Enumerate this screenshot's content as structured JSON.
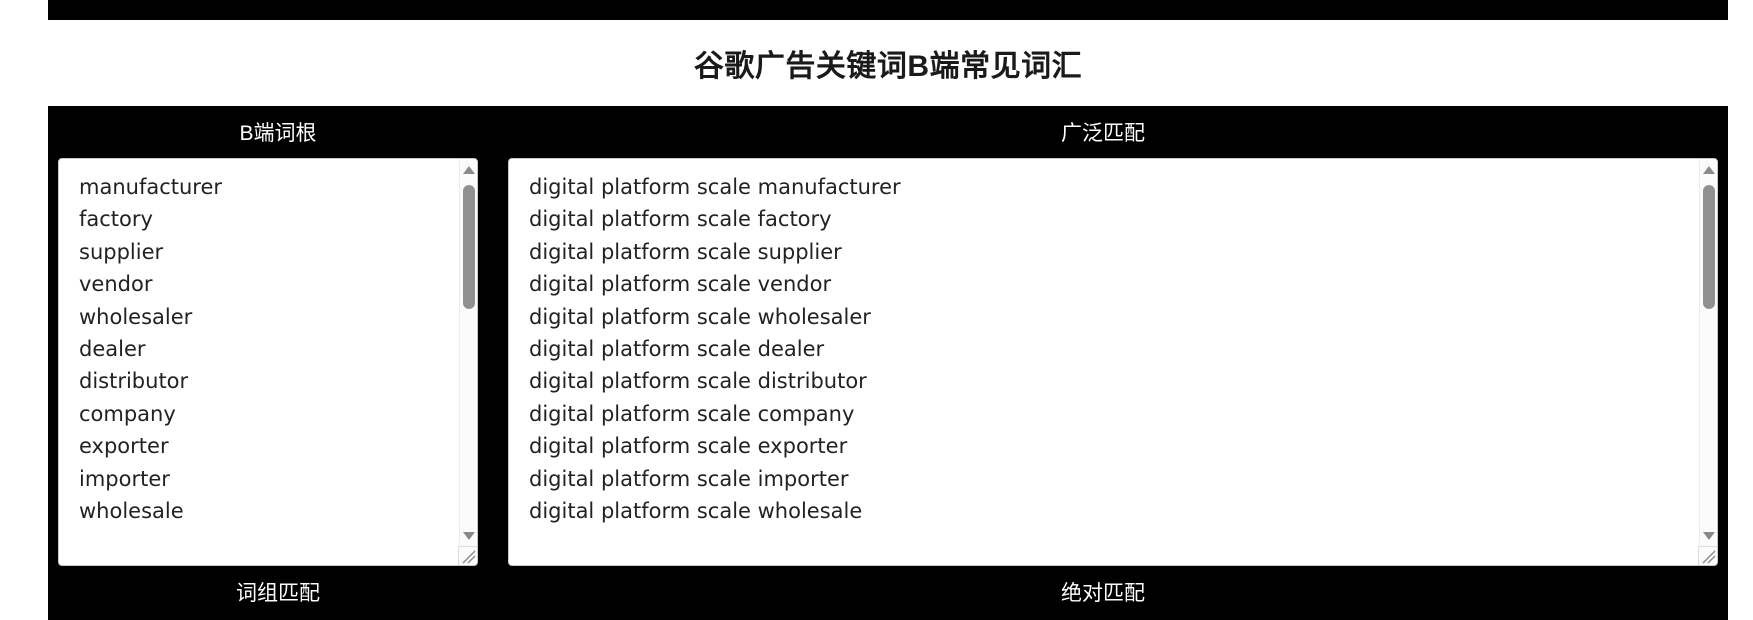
{
  "page": {
    "title": "谷歌广告关键词B端常见词汇"
  },
  "columns": {
    "row1": {
      "left_header": "B端词根",
      "right_header": "广泛匹配"
    },
    "row2": {
      "left_header": "词组匹配",
      "right_header": "绝对匹配"
    }
  },
  "left_textarea": {
    "lines": [
      "manufacturer",
      "factory",
      "supplier",
      "vendor",
      "wholesaler",
      "dealer",
      "distributor",
      "company",
      "exporter",
      "importer",
      "wholesale"
    ]
  },
  "right_textarea": {
    "lines": [
      "digital platform scale manufacturer",
      "digital platform scale factory",
      "digital platform scale supplier",
      "digital platform scale vendor",
      "digital platform scale wholesaler",
      "digital platform scale dealer",
      "digital platform scale distributor",
      "digital platform scale company",
      "digital platform scale exporter",
      "digital platform scale importer",
      "digital platform scale wholesale"
    ]
  },
  "icons": {
    "scroll_up": "triangle-up-icon",
    "scroll_down": "triangle-down-icon",
    "resize": "resize-grip-icon"
  },
  "colors": {
    "panel_bg": "#000000",
    "page_bg": "#ffffff",
    "text": "#222222",
    "header_text": "#ffffff",
    "scrollbar": "#909090"
  }
}
